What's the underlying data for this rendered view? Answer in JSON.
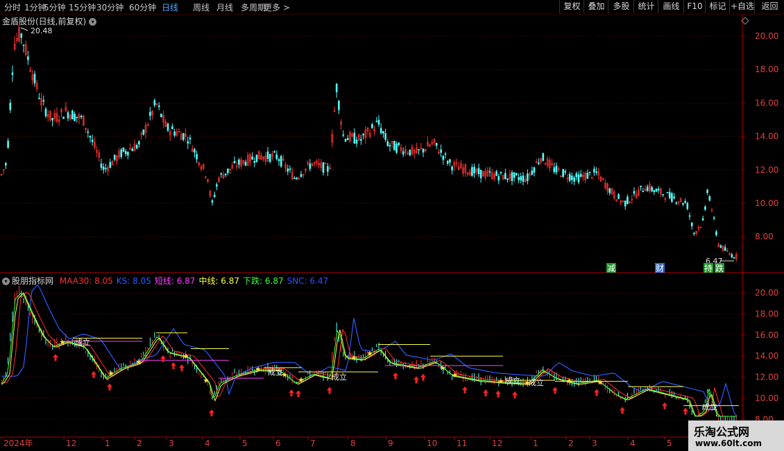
{
  "toolbar": {
    "timeframes": [
      "分时",
      "1分钟",
      "5分钟",
      "15分钟",
      "30分钟",
      "60分钟",
      "日线",
      "周线",
      "月线",
      "多周期",
      "更多"
    ],
    "active_timeframe": "日线",
    "more_arrow": ">",
    "right_buttons": [
      "复权",
      "叠加",
      "多股",
      "统计",
      "画线",
      "F10",
      "标记",
      "+自选",
      "返回"
    ]
  },
  "price_panel": {
    "title": "金盾股份(日线,前复权)",
    "high_label": "20.48",
    "low_label": "6.47",
    "y_ticks": [
      "20.00",
      "18.00",
      "16.00",
      "14.00",
      "12.00",
      "10.00",
      "8.00"
    ],
    "markers": [
      "减",
      "财",
      "持",
      "跌"
    ]
  },
  "indicator_panel": {
    "name": "股朋指标网",
    "items": [
      {
        "label": "MAA30:",
        "value": "8.05",
        "color": "#ff3030"
      },
      {
        "label": "KS:",
        "value": "8.05",
        "color": "#2a5cff"
      },
      {
        "label": "短线:",
        "value": "6.87",
        "color": "#ff40ff"
      },
      {
        "label": "中线:",
        "value": "6.87",
        "color": "#ffff40"
      },
      {
        "label": "下跌:",
        "value": "6.87",
        "color": "#40ff40"
      },
      {
        "label": "SNC:",
        "value": "6.47",
        "color": "#3050ff"
      }
    ],
    "y_ticks": [
      "20.00",
      "18.00",
      "16.00",
      "14.00",
      "12.00",
      "10.00",
      "8.00"
    ],
    "signal_text": "成立"
  },
  "time_axis": [
    "2024年",
    "12",
    "1",
    "2",
    "3",
    "4",
    "5",
    "6",
    "7",
    "8",
    "9",
    "10",
    "11",
    "12",
    "1",
    "2",
    "3",
    "4",
    "5"
  ],
  "watermark": {
    "line1": "乐淘公式网",
    "line2": "www.60lt.com"
  },
  "colors": {
    "up": "#ff3232",
    "down": "#54ffff",
    "grid": "#7a0000",
    "axis": "#b00000"
  }
}
